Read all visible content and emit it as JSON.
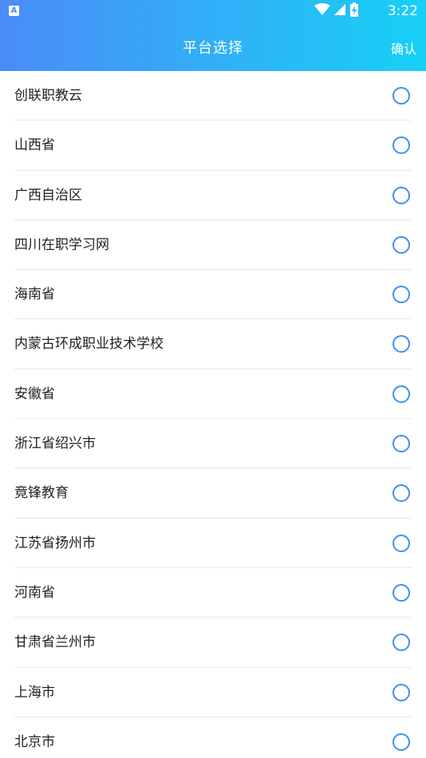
{
  "status_bar": {
    "notification_label": "A",
    "time": "3:22",
    "icons": [
      "wifi-icon",
      "signal-icon",
      "battery-icon"
    ]
  },
  "header": {
    "title": "平台选择",
    "confirm_label": "确认"
  },
  "colors": {
    "header_gradient_start": "#4a8cf7",
    "header_gradient_end": "#17d0f6",
    "radio_border": "#3f8ff5",
    "divider": "#e8e8e8"
  },
  "platforms": [
    {
      "label": "创联职教云",
      "selected": false
    },
    {
      "label": "山西省",
      "selected": false
    },
    {
      "label": "广西自治区",
      "selected": false
    },
    {
      "label": "四川在职学习网",
      "selected": false
    },
    {
      "label": "海南省",
      "selected": false
    },
    {
      "label": "内蒙古环成职业技术学校",
      "selected": false
    },
    {
      "label": "安徽省",
      "selected": false
    },
    {
      "label": "浙江省绍兴市",
      "selected": false
    },
    {
      "label": "竟锋教育",
      "selected": false
    },
    {
      "label": "江苏省扬州市",
      "selected": false
    },
    {
      "label": "河南省",
      "selected": false
    },
    {
      "label": "甘肃省兰州市",
      "selected": false
    },
    {
      "label": "上海市",
      "selected": false
    },
    {
      "label": "北京市",
      "selected": false
    }
  ]
}
